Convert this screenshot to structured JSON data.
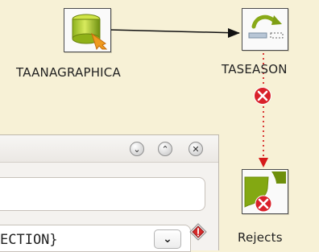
{
  "nodes": {
    "source": {
      "label": "TAANAGRAPHICA",
      "icon": "database-input-icon"
    },
    "target": {
      "label": "TASEASON",
      "icon": "transform-arrow-icon"
    },
    "reject": {
      "label": "Rejects",
      "icon": "reject-output-icon"
    }
  },
  "connections": {
    "main_link": "main-flow-link",
    "reject_link": "reject-flow-link"
  },
  "panel": {
    "buttons": {
      "down": "⌄",
      "up": "⌃",
      "close": "✕"
    },
    "combo_value": "ECTION}",
    "combo_arrow": "⌄"
  },
  "colors": {
    "canvas_bg": "#f7f1d6",
    "flow_line": "#111111",
    "reject_line": "#d51a1a",
    "reject_badge": "#d9212a"
  }
}
